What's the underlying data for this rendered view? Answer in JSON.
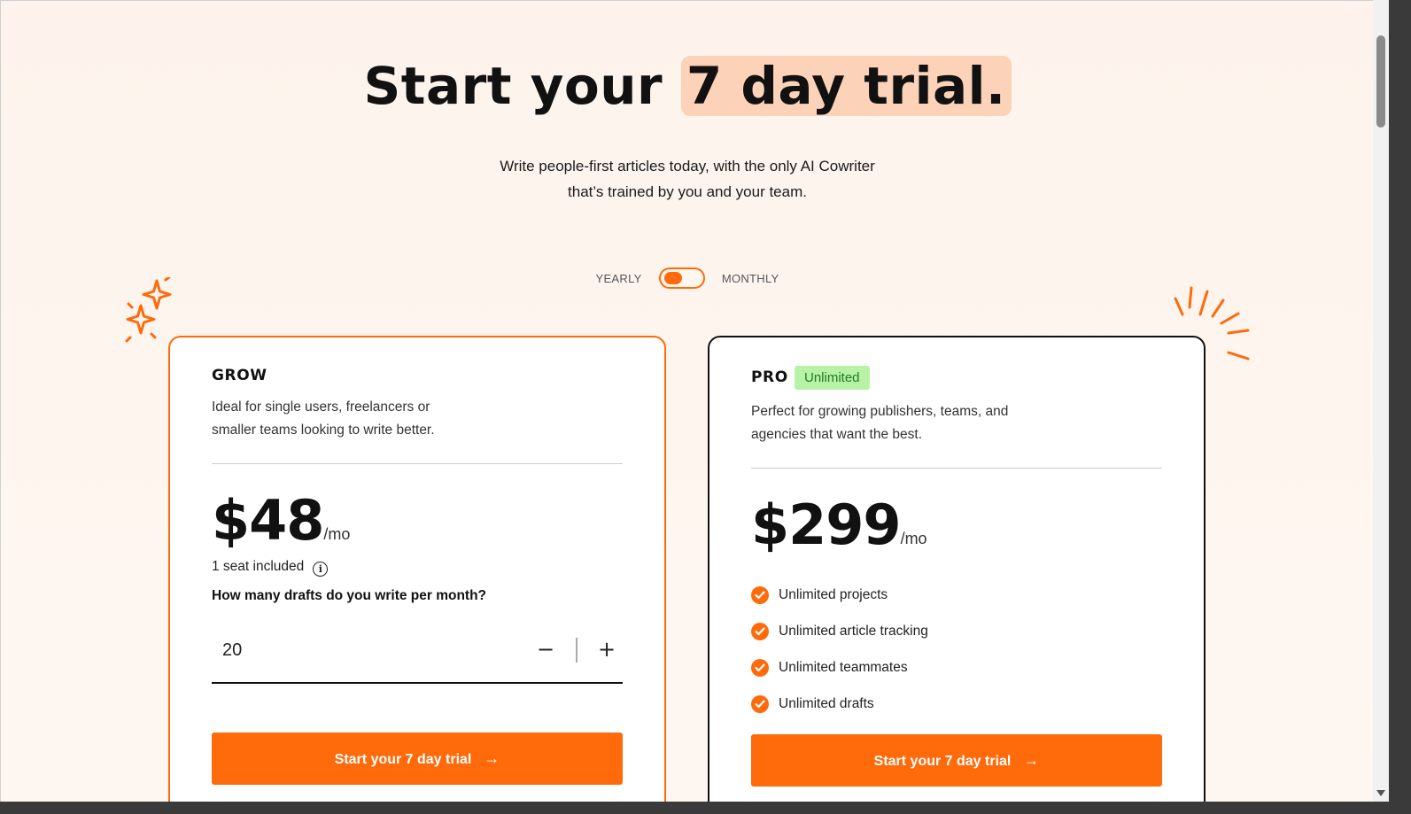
{
  "hero": {
    "title_prefix": "Start your ",
    "title_highlight": "7 day trial.",
    "subtitle_line1": "Write people-first articles today, with the only AI Cowriter",
    "subtitle_line2": "that’s trained by you and your team."
  },
  "billing_toggle": {
    "left_label": "YEARLY",
    "right_label": "MONTHLY",
    "selected": "YEARLY"
  },
  "plans": {
    "grow": {
      "name": "GROW",
      "desc_line1": "Ideal for single users, freelancers or",
      "desc_line2": "smaller teams looking to write better.",
      "price": "$48",
      "per": "/mo",
      "seats": "1 seat included",
      "question": "How many drafts do you write per month?",
      "drafts_value": "20",
      "minus": "−",
      "plus": "+",
      "cta_label": "Start your 7 day trial"
    },
    "pro": {
      "name": "PRO",
      "badge": "Unlimited",
      "desc_line1": "Perfect for growing publishers, teams, and",
      "desc_line2": "agencies that want the best.",
      "price": "$299",
      "per": "/mo",
      "features": [
        "Unlimited projects",
        "Unlimited article tracking",
        "Unlimited teammates",
        "Unlimited drafts"
      ],
      "cta_label": "Start your 7 day trial"
    }
  },
  "colors": {
    "accent": "#ff6a0a",
    "highlight": "#fcd2b8",
    "badge_bg": "#b8f2a6",
    "badge_text": "#1e7a25",
    "background": "#fdf3ec"
  },
  "icons": {
    "info": "info-icon",
    "check": "check-circle-icon",
    "arrow": "arrow-right-icon",
    "sparkle": "sparkle-icon",
    "burst": "burst-lines-icon"
  }
}
